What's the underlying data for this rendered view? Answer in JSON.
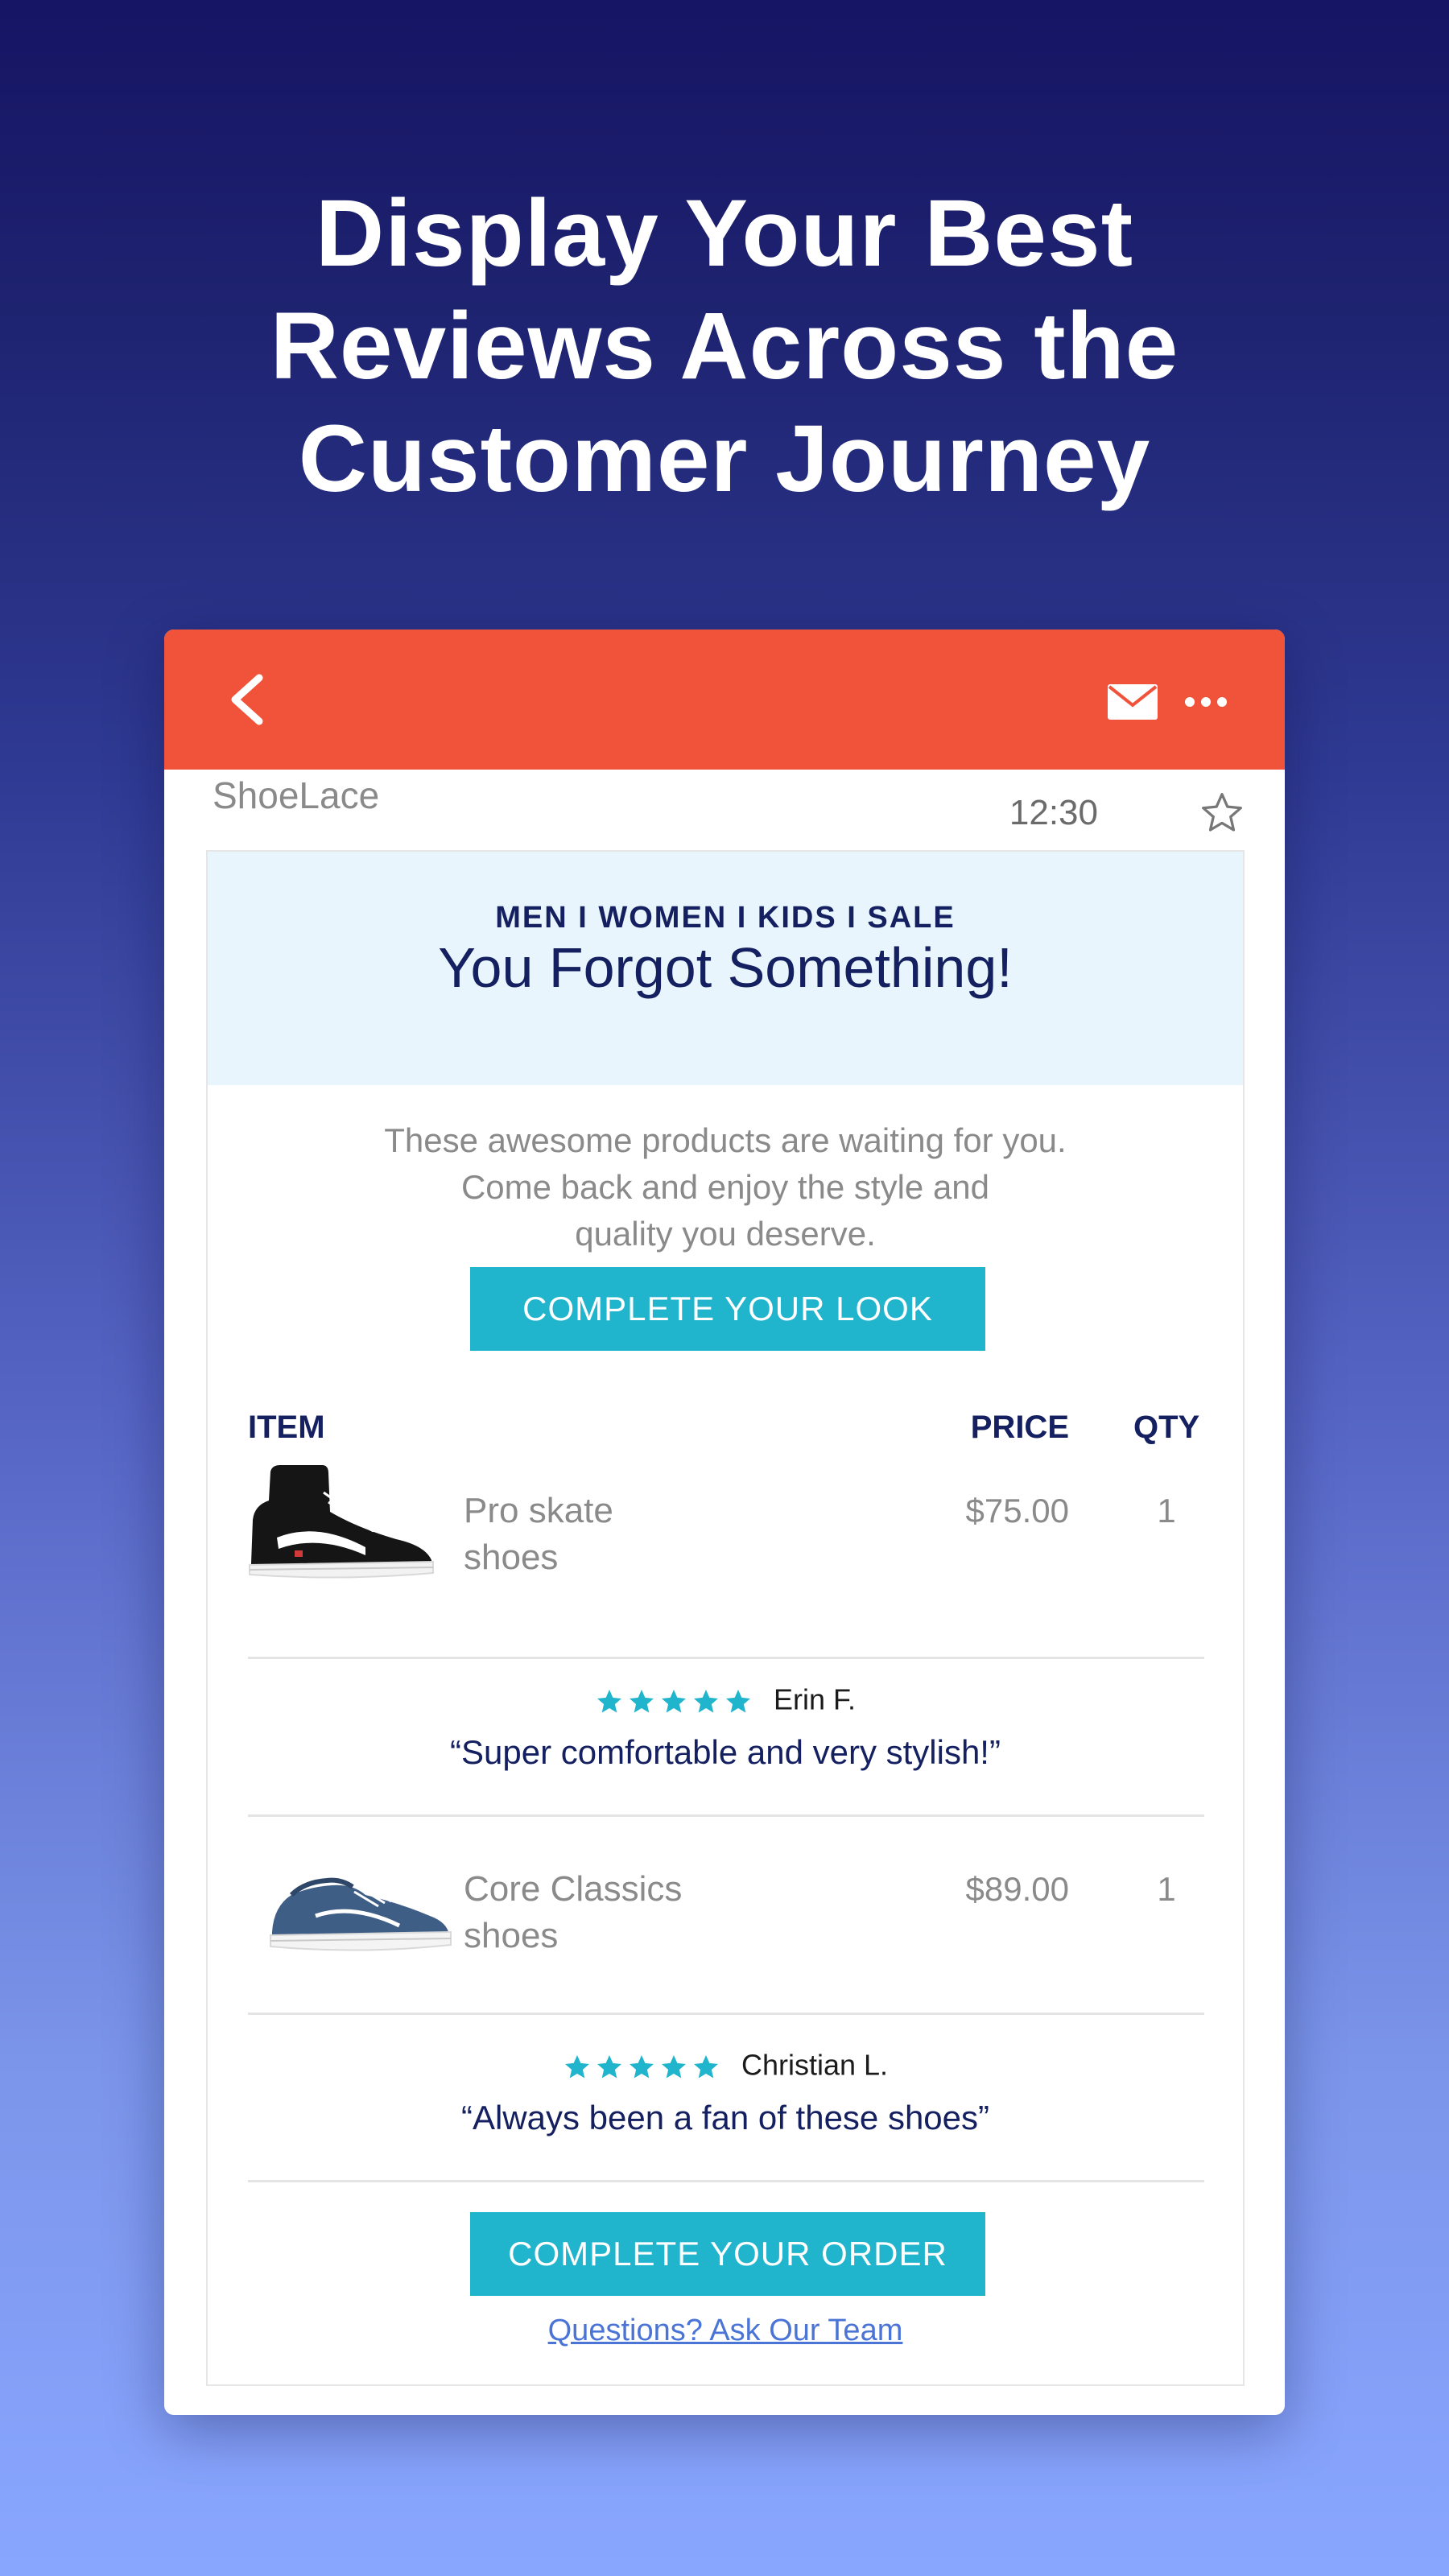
{
  "headline": {
    "line1": "Display Your Best",
    "line2": "Reviews Across the",
    "line3": "Customer Journey"
  },
  "email_app": {
    "sender": "ShoeLace",
    "time": "12:30",
    "icons": {
      "back": "chevron-left-icon",
      "mail": "envelope-icon",
      "more": "more-horizontal-icon",
      "star": "star-outline-icon"
    },
    "colors": {
      "toolbar": "#f05339",
      "accent": "#20b5cc",
      "navy": "#152061",
      "header_bg": "#e8f5fc"
    }
  },
  "email": {
    "nav_links": "MEN I WOMEN I KIDS I SALE",
    "title": "You Forgot Something!",
    "intro_lines": [
      "These awesome products are waiting for you.",
      "Come back and enjoy the style and",
      "quality you deserve."
    ],
    "cta_look": "COMPLETE YOUR LOOK",
    "table_headers": {
      "item": "ITEM",
      "price": "PRICE",
      "qty": "QTY"
    },
    "products": [
      {
        "name_line1": "Pro skate",
        "name_line2": "shoes",
        "price": "$75.00",
        "qty": "1",
        "review": {
          "rating": 5,
          "reviewer": "Erin F.",
          "quote": "“Super comfortable and very stylish!”"
        }
      },
      {
        "name_line1": "Core Classics",
        "name_line2": "shoes",
        "price": "$89.00",
        "qty": "1",
        "review": {
          "rating": 5,
          "reviewer": "Christian L.",
          "quote": "“Always been a fan of these shoes”"
        }
      }
    ],
    "cta_order": "COMPLETE YOUR ORDER",
    "help_link": "Questions? Ask Our Team"
  }
}
